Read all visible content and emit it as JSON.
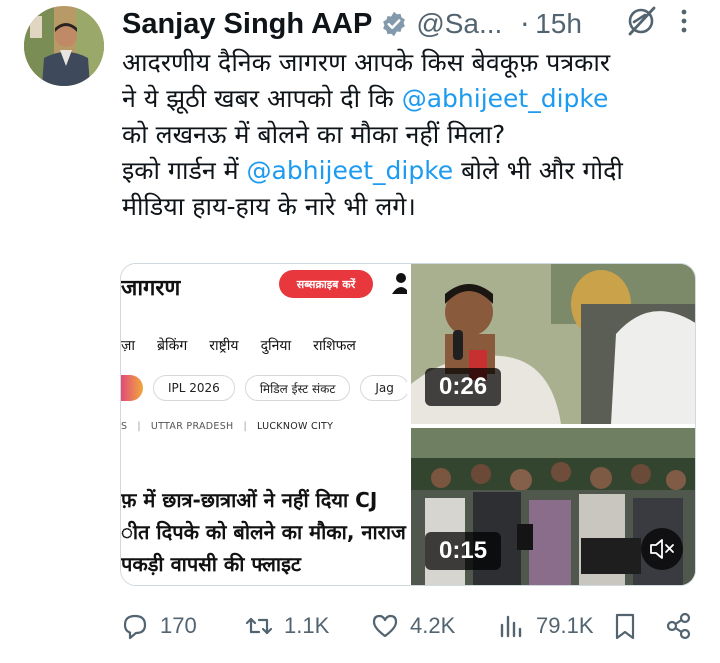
{
  "author": {
    "name": "Sanjay Singh AAP",
    "handle": "@Sa...",
    "separator": "·",
    "time": "15h"
  },
  "tweet": {
    "lines": [
      [
        {
          "text": "आदरणीय दैनिक जागरण आपके किस बेवकूफ़ पत्रकार",
          "mention": false
        }
      ],
      [
        {
          "text": "ने ये झूठी खबर आपको दी कि ",
          "mention": false
        },
        {
          "text": "@abhijeet_dipke",
          "mention": true
        }
      ],
      [
        {
          "text": "को लखनऊ में बोलने का मौका नहीं मिला?",
          "mention": false
        }
      ],
      [
        {
          "text": "इको गार्डन में ",
          "mention": false
        },
        {
          "text": "@abhijeet_dipke",
          "mention": true
        },
        {
          "text": " बोले भी और गोदी",
          "mention": false
        }
      ],
      [
        {
          "text": "मीडिया हाय-हाय के नारे भी लगे।",
          "mention": false
        }
      ]
    ]
  },
  "article": {
    "brand": "जागरण",
    "subscribe_label": "सब्सक्राइब करें",
    "nav": [
      "ज़ा",
      "ब्रेकिंग",
      "राष्ट्रीय",
      "दुनिया",
      "राशिफल"
    ],
    "chips": [
      "IPL 2026",
      "मिडिल ईस्ट संकट",
      "Jag"
    ],
    "breadcrumbs": [
      "S",
      "UTTAR PRADESH",
      "LUCKNOW CITY"
    ],
    "headline_lines": [
      "फ़ में छात्र-छात्राओं ने नहीं दिया CJ",
      "ीत दिपके को बोलने का मौका, नाराज",
      "पकड़ी वापसी की फ्लाइट"
    ]
  },
  "videos": [
    {
      "duration": "0:26"
    },
    {
      "duration": "0:15"
    }
  ],
  "actions": {
    "replies": "170",
    "reposts": "1.1K",
    "likes": "4.2K",
    "views": "79.1K"
  },
  "colors": {
    "accent": "#1d9bf0",
    "secondary_text": "#536471",
    "text": "#0f1419",
    "subscribe_button": "#e8383d"
  },
  "icons": [
    "verified-badge-icon",
    "grok-icon",
    "more-options-icon",
    "user-icon",
    "mute-icon",
    "reply-icon",
    "repost-icon",
    "like-icon",
    "views-icon",
    "bookmark-icon",
    "share-icon"
  ]
}
